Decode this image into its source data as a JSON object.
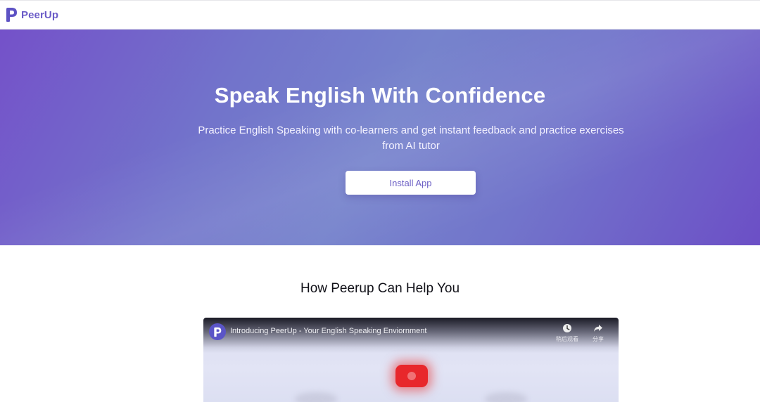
{
  "header": {
    "brand_name": "PeerUp",
    "logo_icon": "peerup-logo-icon",
    "brand_color": "#6a5bc7"
  },
  "hero": {
    "title": "Speak English With Confidence",
    "subtitle": "Practice English Speaking with co-learners and get instant feedback and practice exercises from AI tutor",
    "cta_label": "Install App",
    "gradient_colors": [
      "#7451c9",
      "#7683cc",
      "#6c4fc6"
    ]
  },
  "section": {
    "title": "How Peerup Can Help You"
  },
  "video": {
    "title": "Introducing PeerUp - Your English Speaking Enviornment",
    "watch_later_label": "稍后观看",
    "share_label": "分享",
    "watch_later_icon": "clock-icon",
    "share_icon": "share-arrow-icon",
    "play_icon": "play-button-icon",
    "play_color": "#e8272b"
  }
}
